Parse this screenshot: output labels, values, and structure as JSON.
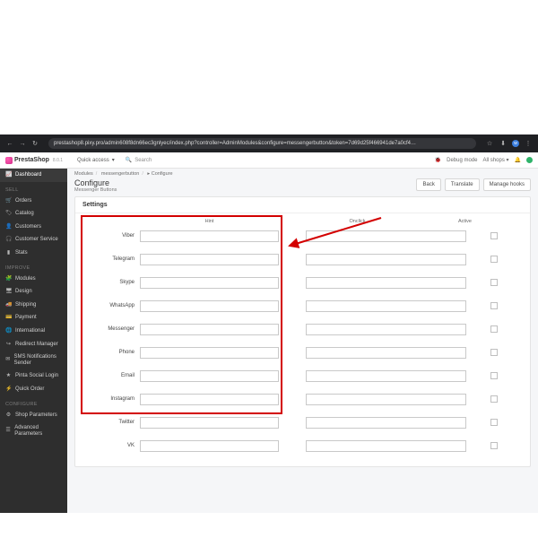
{
  "browser": {
    "url": "prestashop8.pixy.pro/admin608f8dn66ec3gnlyec/index.php?controller=AdminModules&configure=messengerbutton&token=7d69d25f466941de7a0cf4…"
  },
  "brand": {
    "name": "PrestaShop",
    "version": "8.0.1"
  },
  "header": {
    "quick_access": "Quick access",
    "search_placeholder": "Search",
    "debug": "Debug mode",
    "shops": "All shops"
  },
  "sidebar": {
    "dashboard": "Dashboard",
    "section_sell": "SELL",
    "orders": "Orders",
    "catalog": "Catalog",
    "customers": "Customers",
    "customer_service": "Customer Service",
    "stats": "Stats",
    "section_improve": "IMPROVE",
    "modules": "Modules",
    "design": "Design",
    "shipping": "Shipping",
    "payment": "Payment",
    "international": "International",
    "redirect_manager": "Redirect Manager",
    "sms_notifications": "SMS Notifications Sender",
    "pinta_social": "Pinta Social Login",
    "quick_order": "Quick Order",
    "section_configure": "CONFIGURE",
    "shop_parameters": "Shop Parameters",
    "advanced": "Advanced Parameters"
  },
  "breadcrumb": {
    "a": "Modules",
    "b": "messengerbutton",
    "c": "Configure"
  },
  "page": {
    "title": "Configure",
    "subtitle": "Messenger Buttons",
    "btn_back": "Back",
    "btn_translate": "Translate",
    "btn_hooks": "Manage hooks"
  },
  "panel": {
    "title": "Settings",
    "th_hint": "Hint",
    "th_onclick": "Onclick",
    "th_active": "Active",
    "rows": [
      {
        "label": "Viber"
      },
      {
        "label": "Telegram"
      },
      {
        "label": "Skype"
      },
      {
        "label": "WhatsApp"
      },
      {
        "label": "Messenger"
      },
      {
        "label": "Phone"
      },
      {
        "label": "Email"
      },
      {
        "label": "Instagram"
      },
      {
        "label": "Twitter"
      },
      {
        "label": "VK"
      }
    ]
  }
}
